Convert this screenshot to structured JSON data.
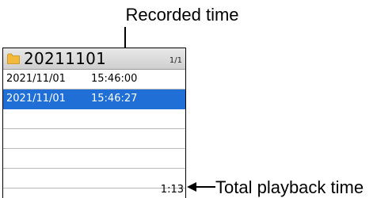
{
  "callouts": {
    "recorded_time_label": "Recorded time",
    "total_playback_time_label": "Total playback time"
  },
  "header": {
    "folder_icon": "folder-icon",
    "folder_icon_color": "#f2b93b",
    "folder_name": "20211101",
    "page_indicator": "1/1"
  },
  "rows": [
    {
      "date": "2021/11/01",
      "time": "15:46:00",
      "selected": false
    },
    {
      "date": "2021/11/01",
      "time": "15:46:27",
      "selected": true
    },
    {
      "date": "",
      "time": "",
      "selected": false
    },
    {
      "date": "",
      "time": "",
      "selected": false
    },
    {
      "date": "",
      "time": "",
      "selected": false
    },
    {
      "date": "",
      "time": "",
      "selected": false
    }
  ],
  "footer": {
    "total_time": "1:13"
  },
  "colors": {
    "selection": "#1f6fd6",
    "header_bg": "#dcdcdc"
  }
}
